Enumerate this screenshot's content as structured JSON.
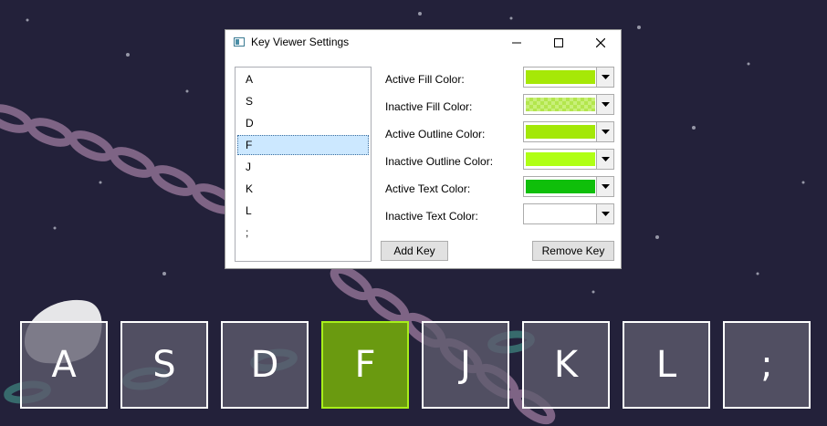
{
  "window": {
    "title": "Key Viewer Settings",
    "minimize_icon": "minimize-icon",
    "maximize_icon": "maximize-icon",
    "close_icon": "close-icon"
  },
  "key_list": {
    "items": [
      "A",
      "S",
      "D",
      "F",
      "J",
      "K",
      "L",
      ";"
    ],
    "selected": "F"
  },
  "settings": {
    "active_fill": {
      "label": "Active Fill Color:",
      "color": "#a6e807"
    },
    "inactive_fill": {
      "label": "Inactive Fill Color:",
      "color": "#c9f07a"
    },
    "active_outline": {
      "label": "Active Outline Color:",
      "color": "#a3e807"
    },
    "inactive_outline": {
      "label": "Inactive Outline Color:",
      "color": "#b0ff14"
    },
    "active_text": {
      "label": "Active Text Color:",
      "color": "#0fbf0a"
    },
    "inactive_text": {
      "label": "Inactive Text Color:",
      "color": "#ffffff"
    }
  },
  "buttons": {
    "add_key": "Add Key",
    "remove_key": "Remove Key"
  },
  "tiles": {
    "keys": [
      "A",
      "S",
      "D",
      "F",
      "J",
      "K",
      "L",
      ";"
    ],
    "active_key": "F"
  },
  "colors": {
    "background": "#23213a",
    "tile_inactive_fill": "#5f5c6e",
    "tile_active_fill": "#6a9a10",
    "tile_active_outline": "#a8ef1a",
    "tile_inactive_outline": "#ffffff"
  }
}
